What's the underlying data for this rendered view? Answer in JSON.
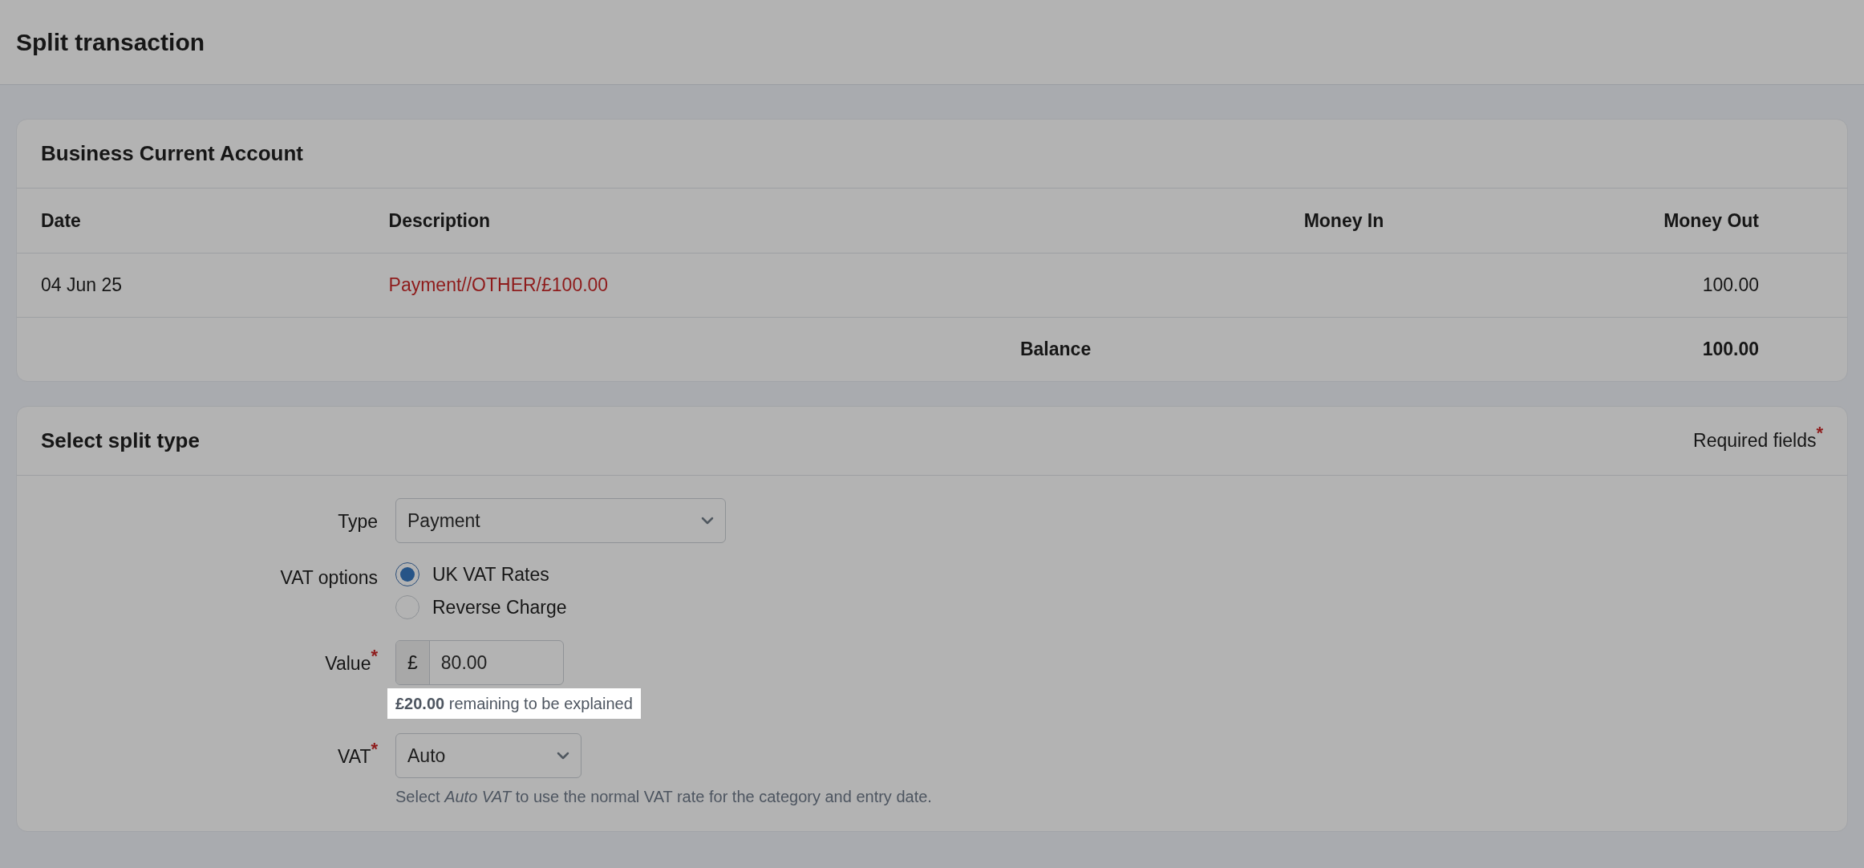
{
  "page": {
    "title": "Split transaction"
  },
  "account_card": {
    "title": "Business Current Account",
    "columns": [
      "Date",
      "Description",
      "Money In",
      "Money Out"
    ],
    "rows": [
      {
        "date": "04 Jun 25",
        "description": "Payment//OTHER/£100.00",
        "money_out": "100.00"
      }
    ],
    "total": {
      "label": "Balance",
      "value": "100.00"
    }
  },
  "split_card": {
    "title": "Select split type",
    "required_note": "Required fields",
    "required_mark": "*",
    "fields": [
      {
        "kind": "select",
        "label": "Type",
        "value": "Payment"
      },
      {
        "kind": "radio",
        "label": "VAT options",
        "options": [
          {
            "label": "UK VAT Rates",
            "selected": true
          },
          {
            "label": "Reverse Charge",
            "selected": false
          }
        ]
      },
      {
        "kind": "money",
        "label": "Value",
        "required_mark": "*",
        "prefix": "£",
        "value": "80.00",
        "help": "**£20.00** remaining to be explained",
        "highlighted": true
      },
      {
        "kind": "select",
        "label": "VAT",
        "required_mark": "*",
        "value": "Auto",
        "help": "Select *Auto VAT* to use the normal VAT rate for the category and entry date.",
        "highlighted": false
      }
    ]
  }
}
